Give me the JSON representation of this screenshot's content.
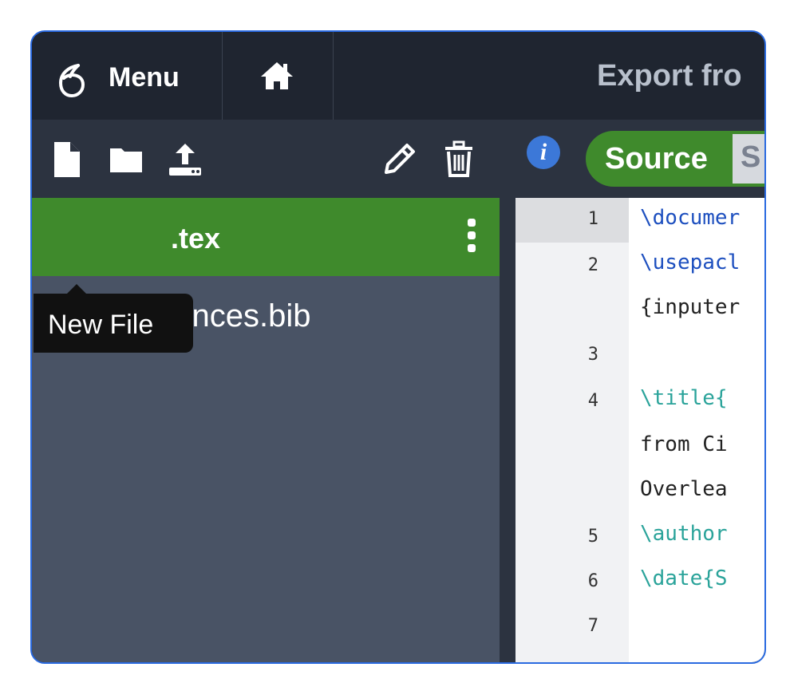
{
  "header": {
    "menu_label": "Menu",
    "title": "Export fro"
  },
  "sidebar": {
    "toolbar": {
      "new_file_icon": "file-icon",
      "new_folder_icon": "folder-icon",
      "upload_icon": "upload-icon",
      "rename_icon": "pencil-icon",
      "delete_icon": "trash-icon"
    },
    "files": [
      {
        "name": ".tex",
        "selected": true,
        "icon": "tex-file-icon"
      },
      {
        "name": "references.bib",
        "selected": false,
        "icon": "bib-linked-icon"
      }
    ],
    "tooltip": "New File"
  },
  "editor_toolbar": {
    "info_label": "i",
    "source_label": "Source",
    "rich_label": "S"
  },
  "editor": {
    "line_numbers": [
      "1",
      "2",
      "3",
      "4",
      "5",
      "6",
      "7"
    ],
    "lines": [
      {
        "n": "1",
        "text": "\\documer"
      },
      {
        "n": "2",
        "text": "\\usepacl"
      },
      {
        "n": "",
        "text": "{inputer"
      },
      {
        "n": "3",
        "text": ""
      },
      {
        "n": "4",
        "text": "\\title{"
      },
      {
        "n": "",
        "text": "from Ci"
      },
      {
        "n": "",
        "text": "Overlea"
      },
      {
        "n": "5",
        "text": "\\author"
      },
      {
        "n": "6",
        "text": "\\date{S"
      },
      {
        "n": "7",
        "text": ""
      }
    ]
  },
  "colors": {
    "accent_green": "#3f8a2c",
    "dark_bg": "#1f2530",
    "sidebar_bg": "#495365",
    "info_blue": "#3c78d8"
  }
}
